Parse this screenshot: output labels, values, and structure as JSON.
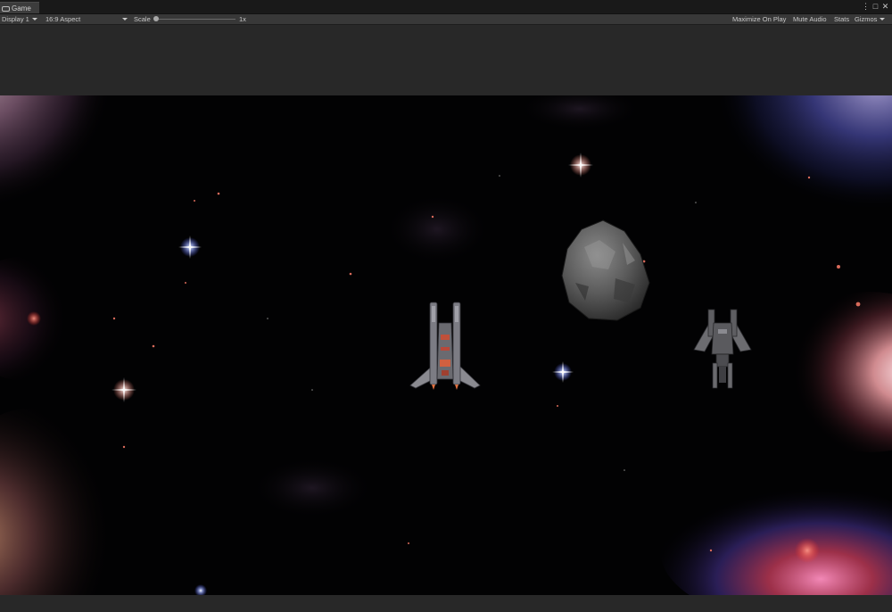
{
  "tab": {
    "label": "Game",
    "icon": "gamepad-icon"
  },
  "window_controls": {
    "more": "⋮",
    "maximize": "□",
    "close": "✕"
  },
  "toolbar": {
    "display": "Display 1",
    "aspect": "16:9 Aspect",
    "scale_label": "Scale",
    "scale_value": "1x",
    "scale_level": 0,
    "maximize_on_play": "Maximize On Play",
    "mute_audio": "Mute Audio",
    "stats": "Stats",
    "gizmos": "Gizmos"
  },
  "colors": {
    "editor_bg": "#282828",
    "toolbar_bg": "#383838",
    "space_bg": "#020203"
  }
}
